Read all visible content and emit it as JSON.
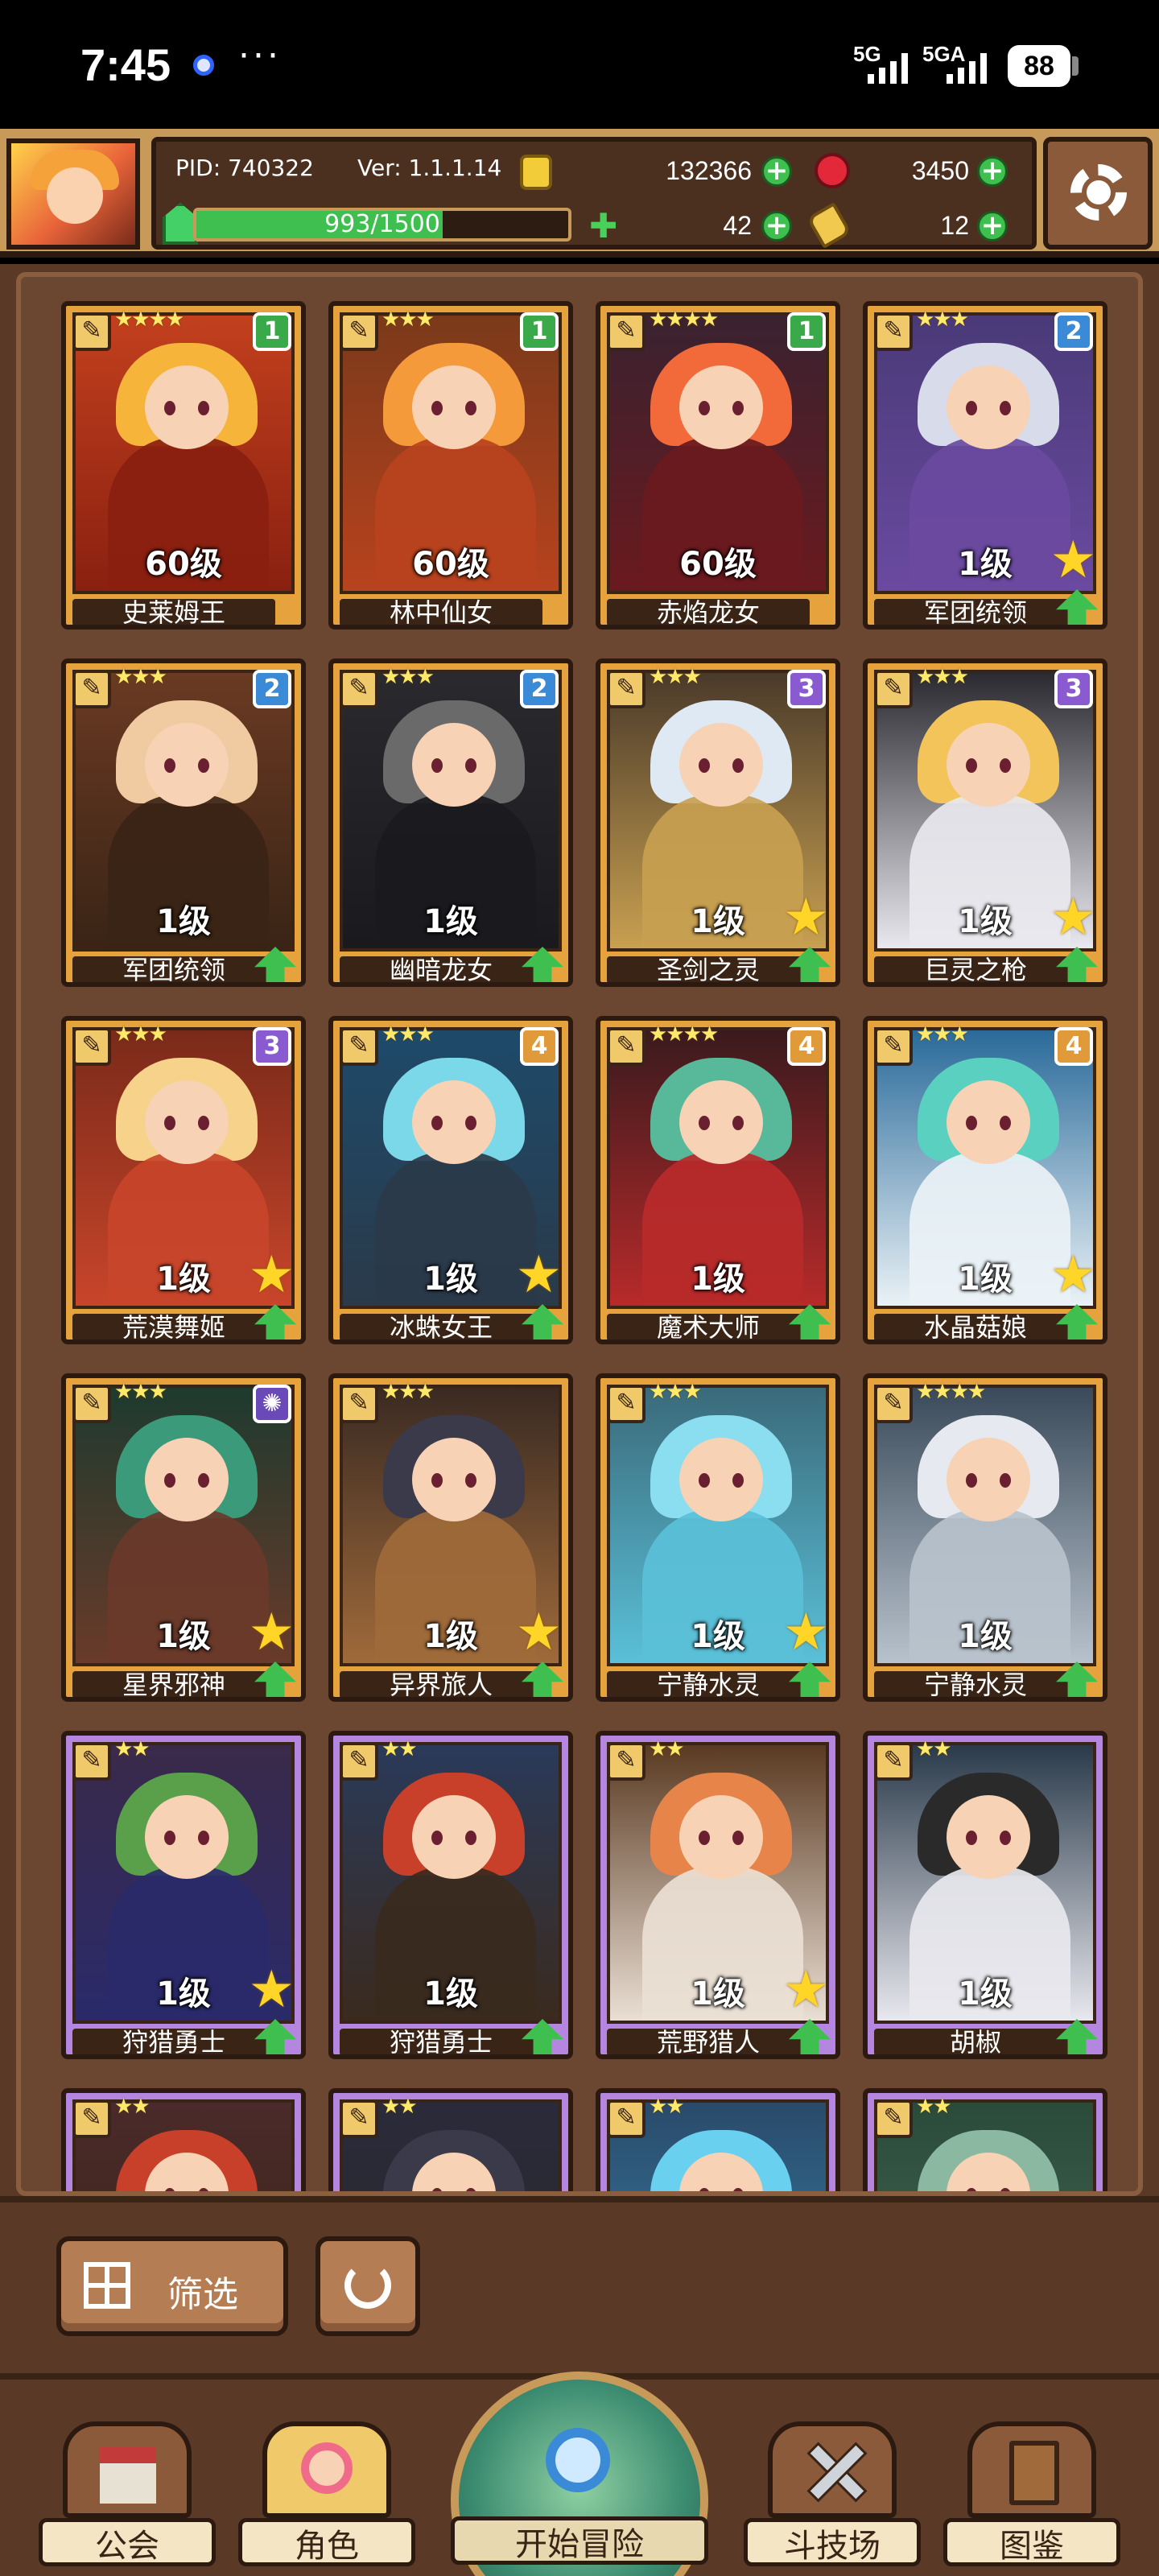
{
  "status_bar": {
    "time": "7:45",
    "more": "···",
    "network1": "5G",
    "network2": "5GA",
    "battery": "88"
  },
  "header": {
    "pid": "PID: 740322",
    "version": "Ver: 1.1.1.14",
    "gold": "132366",
    "gems": "3450",
    "clover": "42",
    "potion": "12",
    "xp_text": "993/1500",
    "xp_progress": 0.662
  },
  "cards": [
    {
      "name": "史莱姆王",
      "level": "60级",
      "stars": "★★★★",
      "badge": "1",
      "badge_color": "#3aa94a",
      "frame": "gold",
      "palette": [
        "#c2401e",
        "#f6b43a",
        "#8a2010"
      ],
      "show_star": false,
      "show_up": false
    },
    {
      "name": "林中仙女",
      "level": "60级",
      "stars": "★★★",
      "badge": "1",
      "badge_color": "#3aa94a",
      "frame": "gold",
      "palette": [
        "#7a3a1a",
        "#f59a3a",
        "#b8421e"
      ],
      "show_star": false,
      "show_up": false
    },
    {
      "name": "赤焰龙女",
      "level": "60级",
      "stars": "★★★★",
      "badge": "1",
      "badge_color": "#3aa94a",
      "frame": "gold",
      "palette": [
        "#3a2230",
        "#f26a3a",
        "#6a1a1e"
      ],
      "show_star": false,
      "show_up": false
    },
    {
      "name": "军团统领",
      "level": "1级",
      "stars": "★★★",
      "badge": "2",
      "badge_color": "#3a8ad8",
      "frame": "gold",
      "palette": [
        "#4a3a78",
        "#d8dcea",
        "#6a4aa0"
      ],
      "show_star": true,
      "show_up": true
    },
    {
      "name": "军团统领",
      "level": "1级",
      "stars": "★★★",
      "badge": "2",
      "badge_color": "#3a8ad8",
      "frame": "gold",
      "palette": [
        "#6a3a22",
        "#f0caa0",
        "#3a2416"
      ],
      "show_star": false,
      "show_up": true
    },
    {
      "name": "幽暗龙女",
      "level": "1级",
      "stars": "★★★",
      "badge": "2",
      "badge_color": "#3a8ad8",
      "frame": "gold",
      "palette": [
        "#2a2a2e",
        "#6a6a6a",
        "#1a1a1e"
      ],
      "show_star": false,
      "show_up": true
    },
    {
      "name": "圣剑之灵",
      "level": "1级",
      "stars": "★★★",
      "badge": "3",
      "badge_color": "#8a5ad0",
      "frame": "gold",
      "palette": [
        "#4a3a2a",
        "#dfe9f4",
        "#c8a050"
      ],
      "show_star": true,
      "show_up": true
    },
    {
      "name": "巨灵之枪",
      "level": "1级",
      "stars": "★★★",
      "badge": "3",
      "badge_color": "#8a5ad0",
      "frame": "gold",
      "palette": [
        "#2a2a30",
        "#f2c45a",
        "#e8e8ee"
      ],
      "show_star": true,
      "show_up": true
    },
    {
      "name": "荒漠舞姬",
      "level": "1级",
      "stars": "★★★",
      "badge": "3",
      "badge_color": "#8a5ad0",
      "frame": "gold",
      "palette": [
        "#7a2a1a",
        "#f6d28a",
        "#c8452a"
      ],
      "show_star": true,
      "show_up": true
    },
    {
      "name": "冰蛛女王",
      "level": "1级",
      "stars": "★★★",
      "badge": "4",
      "badge_color": "#e09a3a",
      "frame": "gold",
      "palette": [
        "#1e4a6a",
        "#7ad8e8",
        "#2a3a4a"
      ],
      "show_star": true,
      "show_up": true
    },
    {
      "name": "魔术大师",
      "level": "1级",
      "stars": "★★★★",
      "badge": "4",
      "badge_color": "#e09a3a",
      "frame": "gold",
      "palette": [
        "#3a1a1e",
        "#58b89a",
        "#b82a2a"
      ],
      "show_star": false,
      "show_up": true
    },
    {
      "name": "水晶菇娘",
      "level": "1级",
      "stars": "★★★",
      "badge": "4",
      "badge_color": "#e09a3a",
      "frame": "gold",
      "palette": [
        "#2a6a9a",
        "#5ad0c0",
        "#eaf2f6"
      ],
      "show_star": true,
      "show_up": true
    },
    {
      "name": "星界邪神",
      "level": "1级",
      "stars": "★★★",
      "badge": "✺",
      "badge_color": "#6a4ab8",
      "frame": "gold",
      "palette": [
        "#1e3a2e",
        "#3a9a7a",
        "#6a3a2a"
      ],
      "show_star": true,
      "show_up": true
    },
    {
      "name": "异界旅人",
      "level": "1级",
      "stars": "★★★",
      "badge": "",
      "badge_color": "",
      "frame": "gold",
      "palette": [
        "#3a2a22",
        "#3a3a4a",
        "#a06a3a"
      ],
      "show_star": true,
      "show_up": true
    },
    {
      "name": "宁静水灵",
      "level": "1级",
      "stars": "★★★",
      "badge": "",
      "badge_color": "",
      "frame": "gold",
      "palette": [
        "#3a6a7a",
        "#8adef0",
        "#5ac0d8"
      ],
      "show_star": true,
      "show_up": true
    },
    {
      "name": "宁静水灵",
      "level": "1级",
      "stars": "★★★★",
      "badge": "",
      "badge_color": "",
      "frame": "gold",
      "palette": [
        "#3a4a5a",
        "#e6eaf0",
        "#b8c2cc"
      ],
      "show_star": false,
      "show_up": true
    },
    {
      "name": "狩猎勇士",
      "level": "1级",
      "stars": "★★",
      "badge": "",
      "badge_color": "",
      "frame": "purple",
      "palette": [
        "#3a2a4a",
        "#5aa04a",
        "#2a2a6a"
      ],
      "show_star": true,
      "show_up": true
    },
    {
      "name": "狩猎勇士",
      "level": "1级",
      "stars": "★★",
      "badge": "",
      "badge_color": "",
      "frame": "purple",
      "palette": [
        "#2a3a5a",
        "#c8402a",
        "#3a2a1e"
      ],
      "show_star": false,
      "show_up": true
    },
    {
      "name": "荒野猎人",
      "level": "1级",
      "stars": "★★",
      "badge": "",
      "badge_color": "",
      "frame": "purple",
      "palette": [
        "#5a3a22",
        "#e6844a",
        "#eadfd4"
      ],
      "show_star": true,
      "show_up": true
    },
    {
      "name": "胡椒",
      "level": "1级",
      "stars": "★★",
      "badge": "",
      "badge_color": "",
      "frame": "purple",
      "palette": [
        "#2a3a4a",
        "#2a2a2a",
        "#e8e8ee"
      ],
      "show_star": false,
      "show_up": true
    },
    {
      "name": "",
      "level": "",
      "stars": "★★",
      "badge": "",
      "badge_color": "",
      "frame": "purple",
      "palette": [
        "#4a2a2a",
        "#c8402a",
        "#3a2416"
      ],
      "show_star": false,
      "show_up": false
    },
    {
      "name": "",
      "level": "",
      "stars": "★★",
      "badge": "",
      "badge_color": "",
      "frame": "purple",
      "palette": [
        "#2a2a3a",
        "#3a3a4a",
        "#2a2a2a"
      ],
      "show_star": false,
      "show_up": false
    },
    {
      "name": "",
      "level": "",
      "stars": "★★",
      "badge": "",
      "badge_color": "",
      "frame": "purple",
      "palette": [
        "#2a4a6a",
        "#6ad0f0",
        "#3a8ab0"
      ],
      "show_star": false,
      "show_up": false
    },
    {
      "name": "",
      "level": "",
      "stars": "★★",
      "badge": "",
      "badge_color": "",
      "frame": "purple",
      "palette": [
        "#2a4a3a",
        "#8ab8a0",
        "#4a6a5a"
      ],
      "show_star": false,
      "show_up": false
    }
  ],
  "filter": {
    "label": "筛选"
  },
  "nav": {
    "guild": "公会",
    "characters": "角色",
    "adventure": "开始冒险",
    "arena": "斗技场",
    "codex": "图鉴"
  }
}
